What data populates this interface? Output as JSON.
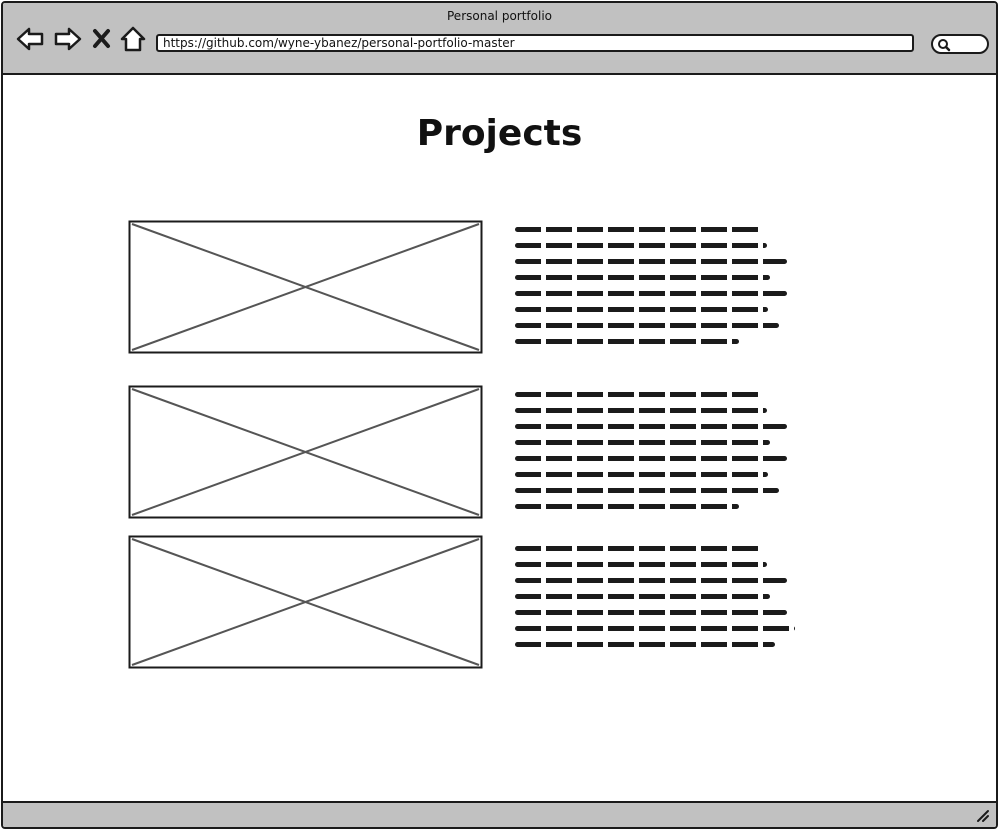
{
  "window": {
    "title": "Personal portfolio"
  },
  "toolbar": {
    "back_icon": "arrow-left-icon",
    "forward_icon": "arrow-right-icon",
    "stop_icon": "close-icon",
    "home_icon": "home-icon",
    "search_icon": "search-icon"
  },
  "address_bar": {
    "url": "https://github.com/wyne-ybanez/personal-portfolio-master"
  },
  "page": {
    "title": "Projects"
  },
  "projects": [
    {
      "image_icon": "image-placeholder-icon",
      "text_line_count": 8
    },
    {
      "image_icon": "image-placeholder-icon",
      "text_line_count": 8
    },
    {
      "image_icon": "image-placeholder-icon",
      "text_line_count": 7
    }
  ],
  "statusbar": {
    "grip_icon": "resize-grip-icon"
  },
  "colors": {
    "chrome": "#c1c1c1",
    "stroke": "#1b1b1b",
    "placeholder_cross": "#555555"
  }
}
